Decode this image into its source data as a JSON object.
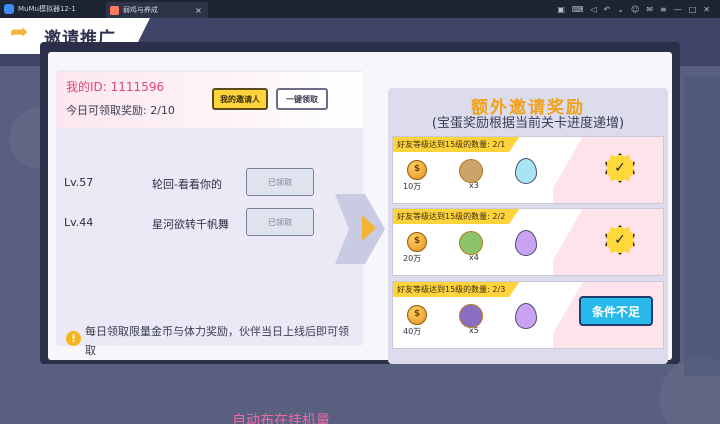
{
  "titlebar": {
    "app_name": "MuMu模拟器12-1",
    "tab_title": "弱鸡与养成",
    "tab_close": "×",
    "icons": [
      "gamepad-icon",
      "keyboard-icon",
      "volume-icon",
      "back-icon",
      "more-icon",
      "user-icon",
      "mail-icon",
      "menu-icon",
      "minimize-icon",
      "maximize-icon",
      "close-icon"
    ]
  },
  "header": {
    "title": "邀请推广",
    "back_glyph": "➦"
  },
  "left": {
    "my_id_label": "我的ID:",
    "my_id_value": "1111596",
    "claim_today": "今日可领取奖励: 2/10",
    "my_inviter_button": "我的邀请人",
    "claim_all_button": "一键领取",
    "friends": [
      {
        "level": "Lv.57",
        "name": "轮回-看看你的",
        "status": "已领取"
      },
      {
        "level": "Lv.44",
        "name": "星河欲转千帆舞",
        "status": "已领取"
      }
    ],
    "notice_icon": "!",
    "notice": "每日领取限量金币与体力奖励，伙伴当日上线后即可领取"
  },
  "right": {
    "title": "额外邀请奖励",
    "subtitle": "(宝蛋奖励根据当前关卡进度递增)",
    "cards": [
      {
        "requirement": "好友等级达到15级的数量: 2/1",
        "coin_amount": "10万",
        "avatar_count": "x3",
        "egg_color": "#a9e4f4",
        "state": "claimed",
        "badge": "✓"
      },
      {
        "requirement": "好友等级达到15级的数量: 2/2",
        "coin_amount": "20万",
        "avatar_count": "x4",
        "egg_color": "#c9a3f1",
        "state": "claimed",
        "badge": "✓"
      },
      {
        "requirement": "好友等级达到15级的数量: 2/3",
        "coin_amount": "40万",
        "avatar_count": "x5",
        "egg_color": "#c9a3f1",
        "state": "unmet",
        "button": "条件不足"
      }
    ]
  },
  "footer_text": "自动布在挂机量"
}
